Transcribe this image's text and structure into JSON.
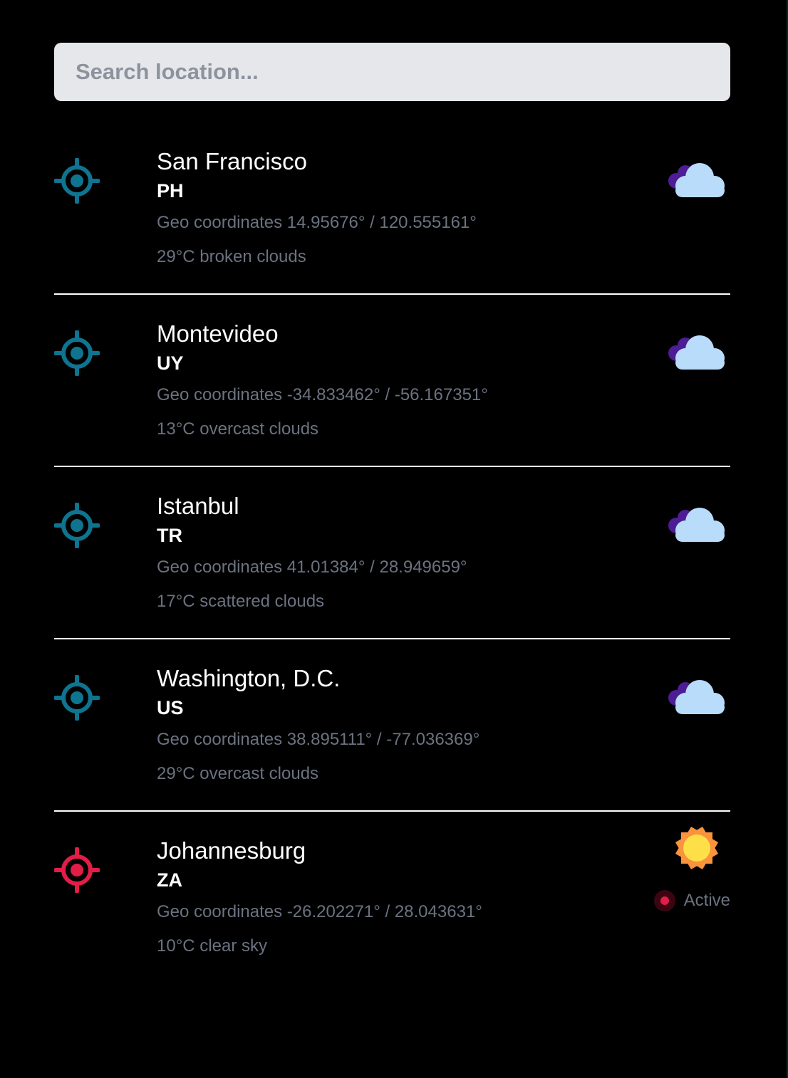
{
  "search": {
    "placeholder": "Search location...",
    "value": ""
  },
  "colors": {
    "background": "#000000",
    "search_bg": "#e5e7eb",
    "location_icon": "#0e7490",
    "active_location_icon": "#e11d48",
    "muted_text": "#6b7280",
    "cloud_front": "#b9dcfb",
    "cloud_back": "#4c1d95",
    "sun_core": "#fde047",
    "sun_rays": "#fb923c"
  },
  "locations": [
    {
      "city": "San Francisco",
      "country": "PH",
      "coords": "Geo coordinates 14.95676° / 120.555161°",
      "weather": "29°C broken clouds",
      "icon": "cloud-icon"
    },
    {
      "city": "Montevideo",
      "country": "UY",
      "coords": "Geo coordinates -34.833462° / -56.167351°",
      "weather": "13°C overcast clouds",
      "icon": "cloud-icon"
    },
    {
      "city": "Istanbul",
      "country": "TR",
      "coords": "Geo coordinates 41.01384° / 28.949659°",
      "weather": "17°C scattered clouds",
      "icon": "cloud-icon"
    },
    {
      "city": "Washington, D.C.",
      "country": "US",
      "coords": "Geo coordinates 38.895111° / -77.036369°",
      "weather": "29°C overcast clouds",
      "icon": "cloud-icon"
    },
    {
      "city": "Johannesburg",
      "country": "ZA",
      "coords": "Geo coordinates -26.202271° / 28.043631°",
      "weather": "10°C clear sky",
      "icon": "sun-icon",
      "status": "Active"
    }
  ]
}
